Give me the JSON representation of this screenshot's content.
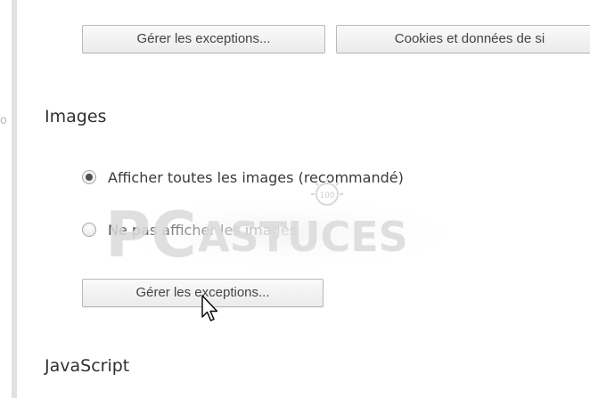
{
  "top_buttons": {
    "manage_exceptions": "Gérer les exceptions...",
    "cookies_site_data": "Cookies et données de si"
  },
  "images_section": {
    "title": "Images",
    "options": [
      {
        "label": "Afficher toutes les images (recommandé)",
        "checked": true
      },
      {
        "label": "Ne pas afficher les images",
        "checked": false
      }
    ],
    "manage_exceptions": "Gérer les exceptions..."
  },
  "javascript_section": {
    "title": "JavaScript"
  },
  "watermark": {
    "brand_big": "PC",
    "brand_small": "ASTUCES",
    "badge": "100"
  },
  "colors": {
    "border": "#e1e1e1",
    "button_border": "#b9b9b9",
    "text": "#333333",
    "radio_dot": "#505050",
    "watermark": "#d9d9d9"
  },
  "icons": {
    "cursor": "arrow-pointer-icon"
  }
}
